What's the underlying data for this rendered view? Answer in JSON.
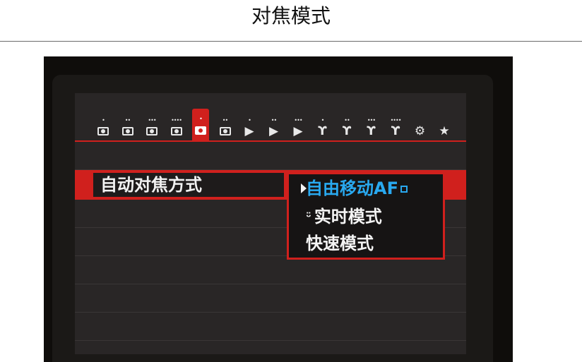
{
  "page": {
    "title": "对焦模式"
  },
  "menu_tabs": [
    {
      "icon": "shooting-tab-1-icon",
      "dots": "•",
      "kind": "cam"
    },
    {
      "icon": "shooting-tab-2-icon",
      "dots": "••",
      "kind": "cam"
    },
    {
      "icon": "shooting-tab-3-icon",
      "dots": "•••",
      "kind": "cam"
    },
    {
      "icon": "shooting-tab-4-icon",
      "dots": "••••",
      "kind": "cam"
    },
    {
      "icon": "live-view-tab-icon",
      "dots": "•",
      "kind": "cam",
      "active": true
    },
    {
      "icon": "shooting-tab-6-icon",
      "dots": "••",
      "kind": "cam"
    },
    {
      "icon": "playback-tab-1-icon",
      "dots": "•",
      "glyph": "▶"
    },
    {
      "icon": "playback-tab-2-icon",
      "dots": "••",
      "glyph": "▶"
    },
    {
      "icon": "playback-tab-3-icon",
      "dots": "•••",
      "glyph": "▶"
    },
    {
      "icon": "setup-tab-1-icon",
      "dots": "•",
      "glyph": "ϒ"
    },
    {
      "icon": "setup-tab-2-icon",
      "dots": "••",
      "glyph": "ϒ"
    },
    {
      "icon": "setup-tab-3-icon",
      "dots": "•••",
      "glyph": "ϒ"
    },
    {
      "icon": "setup-tab-4-icon",
      "dots": "••••",
      "glyph": "ϒ"
    },
    {
      "icon": "custom-functions-tab-icon",
      "dots": "",
      "glyph": "⚙"
    },
    {
      "icon": "my-menu-star-icon",
      "dots": "",
      "glyph": "★"
    }
  ],
  "menu": {
    "row_label": "自动对焦方式",
    "options": [
      {
        "label": "自由移动AF",
        "selected": true
      },
      {
        "label": "实时模式",
        "selected": false
      },
      {
        "label": "快速模式",
        "selected": false
      }
    ]
  },
  "colors": {
    "accent_red": "#d0201d",
    "selected_blue": "#29a9f0",
    "screen_bg": "#292626"
  }
}
